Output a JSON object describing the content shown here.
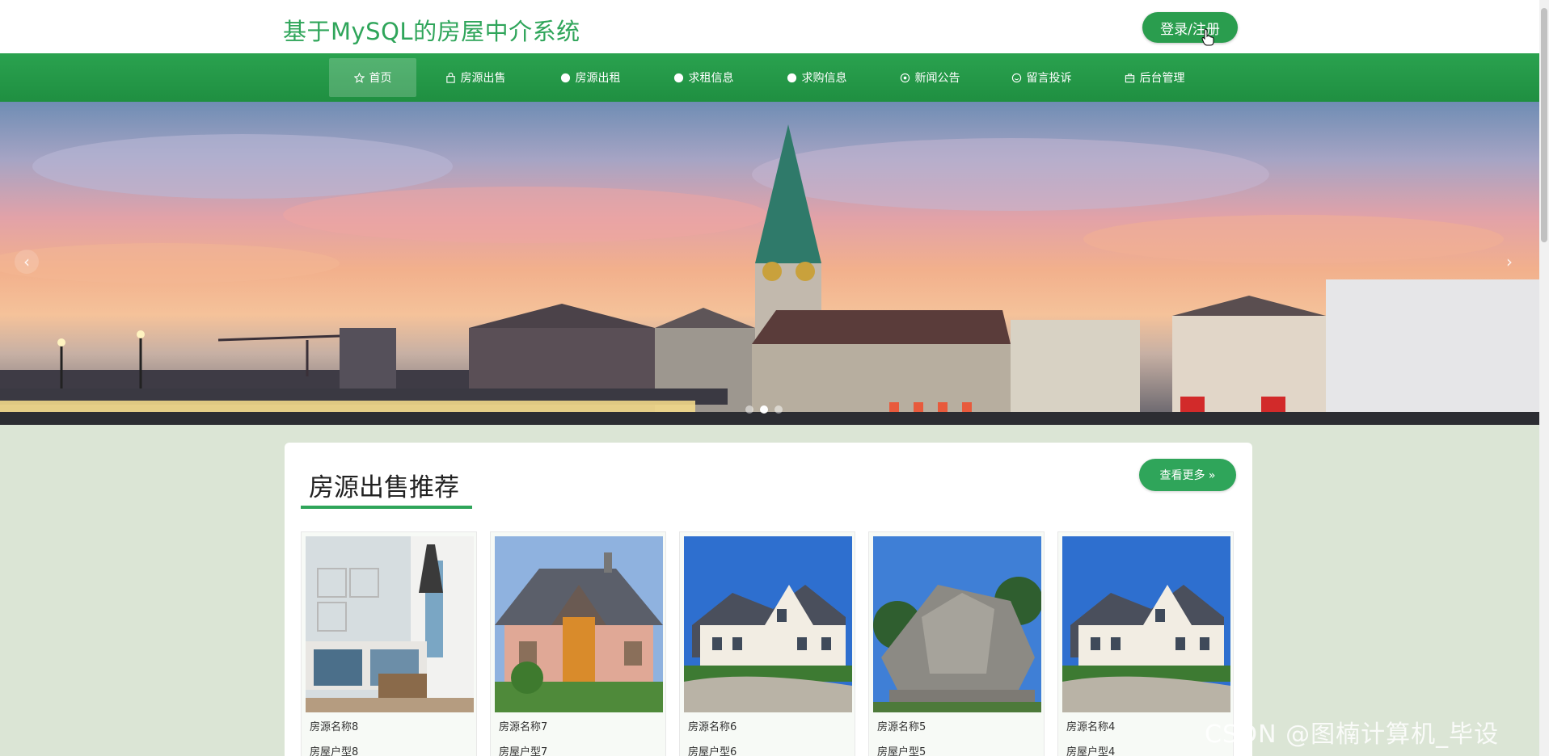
{
  "header": {
    "site_title": "基于MySQL的房屋中介系统",
    "login_label": "登录/注册"
  },
  "nav": {
    "items": [
      {
        "label": "首页",
        "icon": "star-icon",
        "active": true
      },
      {
        "label": "房源出售",
        "icon": "bag-icon"
      },
      {
        "label": "房源出租",
        "icon": "circle-icon"
      },
      {
        "label": "求租信息",
        "icon": "circle-icon"
      },
      {
        "label": "求购信息",
        "icon": "circle-icon"
      },
      {
        "label": "新闻公告",
        "icon": "target-icon"
      },
      {
        "label": "留言投诉",
        "icon": "smile-icon"
      },
      {
        "label": "后台管理",
        "icon": "briefcase-icon"
      }
    ]
  },
  "banner": {
    "prev_glyph": "‹",
    "next_glyph": "›",
    "slide_count": 3,
    "active_slide": 1
  },
  "recommend": {
    "title": "房源出售推荐",
    "more_label": "查看更多 »",
    "cards": [
      {
        "name": "房源名称8",
        "type": "房屋户型8",
        "image": "bedroom-photo"
      },
      {
        "name": "房源名称7",
        "type": "房屋户型7",
        "image": "brick-house-photo"
      },
      {
        "name": "房源名称6",
        "type": "房屋户型6",
        "image": "white-house-photo"
      },
      {
        "name": "房源名称5",
        "type": "房屋户型5",
        "image": "modern-house-photo"
      },
      {
        "name": "房源名称4",
        "type": "房屋户型4",
        "image": "white-house-photo"
      }
    ]
  },
  "watermark": "CSDN @图楠计算机_毕设",
  "colors": {
    "brand_green": "#2fa55a",
    "nav_green": "#239a47",
    "page_bg": "#dbe5d5"
  }
}
